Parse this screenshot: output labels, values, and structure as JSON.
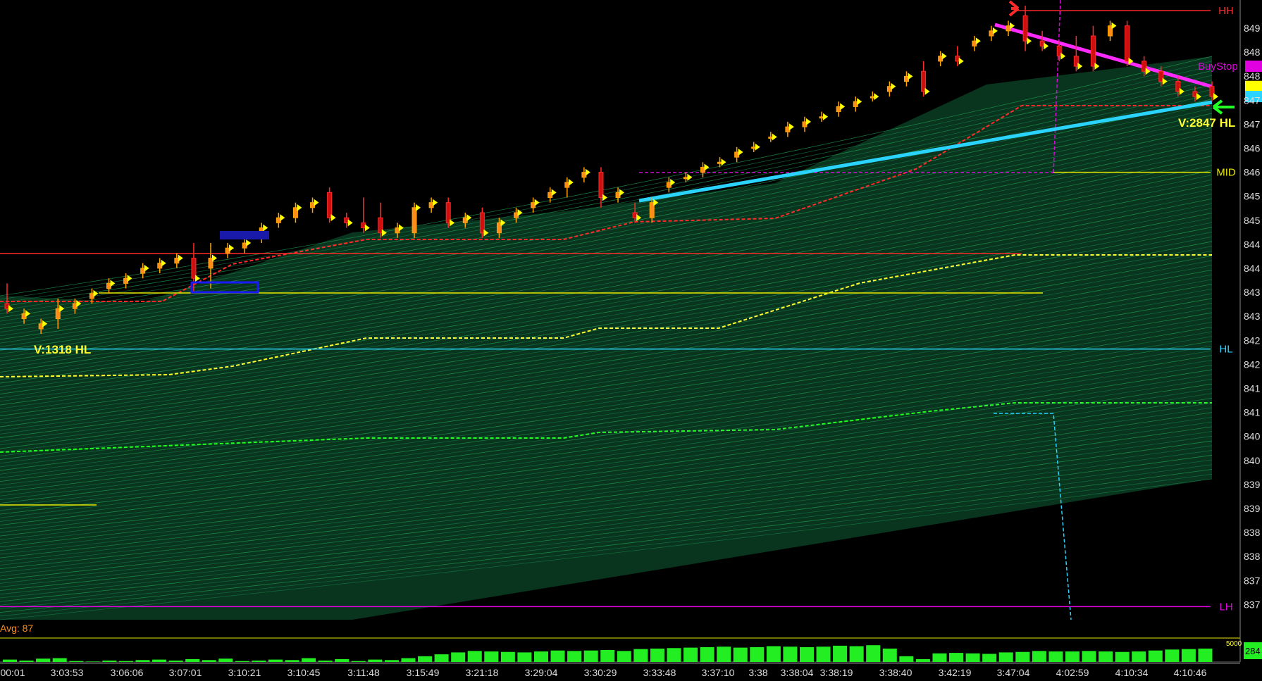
{
  "chart_data": {
    "type": "candlestick",
    "x_tick_labels": [
      "00:01",
      "3:03:53",
      "3:06:06",
      "3:07:01",
      "3:10:21",
      "3:10:45",
      "3:11:48",
      "3:15:49",
      "3:21:18",
      "3:29:04",
      "3:30:29",
      "3:33:48",
      "3:37:10",
      "3:38",
      "3:38:04",
      "3:38:19",
      "3:38:40",
      "3:42:19",
      "3:47:04",
      "4:02:59",
      "4:10:34",
      "4:10:46"
    ],
    "y_tick_labels": [
      "849",
      "848",
      "848",
      "847",
      "847",
      "846",
      "846",
      "845",
      "845",
      "844",
      "844",
      "843",
      "843",
      "842",
      "842",
      "841",
      "841",
      "840",
      "840",
      "839",
      "839",
      "838",
      "838",
      "837",
      "837"
    ],
    "ylim": [
      8370,
      8493
    ],
    "candles": [
      {
        "o": 8434,
        "h": 8438,
        "l": 8432,
        "c": 8433
      },
      {
        "o": 8431,
        "h": 8433,
        "l": 8430,
        "c": 8432
      },
      {
        "o": 8429,
        "h": 8431,
        "l": 8428,
        "c": 8430
      },
      {
        "o": 8431,
        "h": 8435,
        "l": 8429,
        "c": 8433
      },
      {
        "o": 8433,
        "h": 8435,
        "l": 8432,
        "c": 8434
      },
      {
        "o": 8435,
        "h": 8437,
        "l": 8434,
        "c": 8436
      },
      {
        "o": 8437,
        "h": 8439,
        "l": 8436,
        "c": 8438
      },
      {
        "o": 8438,
        "h": 8440,
        "l": 8437,
        "c": 8439
      },
      {
        "o": 8440,
        "h": 8442,
        "l": 8439,
        "c": 8441
      },
      {
        "o": 8441,
        "h": 8443,
        "l": 8440,
        "c": 8442
      },
      {
        "o": 8442,
        "h": 8444,
        "l": 8441,
        "c": 8443
      },
      {
        "o": 8443,
        "h": 8446,
        "l": 8436,
        "c": 8439
      },
      {
        "o": 8441,
        "h": 8446,
        "l": 8437,
        "c": 8443
      },
      {
        "o": 8444,
        "h": 8446,
        "l": 8443,
        "c": 8445
      },
      {
        "o": 8445,
        "h": 8447,
        "l": 8444,
        "c": 8446
      },
      {
        "o": 8447,
        "h": 8450,
        "l": 8446,
        "c": 8449
      },
      {
        "o": 8450,
        "h": 8452,
        "l": 8449,
        "c": 8451
      },
      {
        "o": 8451,
        "h": 8454,
        "l": 8450,
        "c": 8453
      },
      {
        "o": 8453,
        "h": 8455,
        "l": 8452,
        "c": 8454
      },
      {
        "o": 8456,
        "h": 8457,
        "l": 8450,
        "c": 8451
      },
      {
        "o": 8451,
        "h": 8452,
        "l": 8449,
        "c": 8450
      },
      {
        "o": 8450,
        "h": 8455,
        "l": 8448,
        "c": 8449
      },
      {
        "o": 8451,
        "h": 8454,
        "l": 8447,
        "c": 8448
      },
      {
        "o": 8448,
        "h": 8450,
        "l": 8447,
        "c": 8449
      },
      {
        "o": 8448,
        "h": 8454,
        "l": 8447,
        "c": 8453
      },
      {
        "o": 8453,
        "h": 8455,
        "l": 8452,
        "c": 8454
      },
      {
        "o": 8454,
        "h": 8455,
        "l": 8449,
        "c": 8450
      },
      {
        "o": 8450,
        "h": 8452,
        "l": 8449,
        "c": 8451
      },
      {
        "o": 8452,
        "h": 8453,
        "l": 8447,
        "c": 8448
      },
      {
        "o": 8448,
        "h": 8451,
        "l": 8447,
        "c": 8450
      },
      {
        "o": 8451,
        "h": 8453,
        "l": 8450,
        "c": 8452
      },
      {
        "o": 8453,
        "h": 8455,
        "l": 8452,
        "c": 8454
      },
      {
        "o": 8455,
        "h": 8457,
        "l": 8454,
        "c": 8456
      },
      {
        "o": 8457,
        "h": 8459,
        "l": 8455,
        "c": 8458
      },
      {
        "o": 8459,
        "h": 8461,
        "l": 8458,
        "c": 8460
      },
      {
        "o": 8460,
        "h": 8461,
        "l": 8453,
        "c": 8455
      },
      {
        "o": 8455,
        "h": 8457,
        "l": 8454,
        "c": 8456
      },
      {
        "o": 8452,
        "h": 8454,
        "l": 8450,
        "c": 8451
      },
      {
        "o": 8451,
        "h": 8455,
        "l": 8450,
        "c": 8454
      },
      {
        "o": 8457,
        "h": 8459,
        "l": 8456,
        "c": 8458
      },
      {
        "o": 8459,
        "h": 8460,
        "l": 8458,
        "c": 8459
      },
      {
        "o": 8460,
        "h": 8462,
        "l": 8459,
        "c": 8461
      },
      {
        "o": 8462,
        "h": 8463,
        "l": 8461,
        "c": 8462
      },
      {
        "o": 8463,
        "h": 8465,
        "l": 8462,
        "c": 8464
      },
      {
        "o": 8465,
        "h": 8466,
        "l": 8464,
        "c": 8465
      },
      {
        "o": 8467,
        "h": 8468,
        "l": 8466,
        "c": 8467
      },
      {
        "o": 8468,
        "h": 8470,
        "l": 8467,
        "c": 8469
      },
      {
        "o": 8469,
        "h": 8471,
        "l": 8468,
        "c": 8470
      },
      {
        "o": 8471,
        "h": 8472,
        "l": 8470,
        "c": 8471
      },
      {
        "o": 8472,
        "h": 8474,
        "l": 8471,
        "c": 8473
      },
      {
        "o": 8473,
        "h": 8475,
        "l": 8472,
        "c": 8474
      },
      {
        "o": 8475,
        "h": 8476,
        "l": 8474,
        "c": 8475
      },
      {
        "o": 8476,
        "h": 8478,
        "l": 8475,
        "c": 8477
      },
      {
        "o": 8478,
        "h": 8480,
        "l": 8477,
        "c": 8479
      },
      {
        "o": 8480,
        "h": 8482,
        "l": 8475,
        "c": 8476
      },
      {
        "o": 8482,
        "h": 8484,
        "l": 8481,
        "c": 8483
      },
      {
        "o": 8483,
        "h": 8485,
        "l": 8481,
        "c": 8482
      },
      {
        "o": 8485,
        "h": 8487,
        "l": 8484,
        "c": 8486
      },
      {
        "o": 8487,
        "h": 8489,
        "l": 8486,
        "c": 8488
      },
      {
        "o": 8488,
        "h": 8490,
        "l": 8487,
        "c": 8489
      },
      {
        "o": 8491,
        "h": 8493,
        "l": 8484,
        "c": 8486
      },
      {
        "o": 8486,
        "h": 8488,
        "l": 8484,
        "c": 8485
      },
      {
        "o": 8485,
        "h": 8486,
        "l": 8482,
        "c": 8483
      },
      {
        "o": 8483,
        "h": 8487,
        "l": 8480,
        "c": 8481
      },
      {
        "o": 8487,
        "h": 8489,
        "l": 8480,
        "c": 8481
      },
      {
        "o": 8487,
        "h": 8490,
        "l": 8486,
        "c": 8489
      },
      {
        "o": 8489,
        "h": 8490,
        "l": 8481,
        "c": 8482
      },
      {
        "o": 8482,
        "h": 8483,
        "l": 8479,
        "c": 8480
      },
      {
        "o": 8480,
        "h": 8481,
        "l": 8477,
        "c": 8478
      },
      {
        "o": 8478,
        "h": 8479,
        "l": 8475,
        "c": 8476
      },
      {
        "o": 8476,
        "h": 8477,
        "l": 8474,
        "c": 8475
      },
      {
        "o": 8477,
        "h": 8478,
        "l": 8474,
        "c": 8475
      }
    ],
    "levels": [
      {
        "label": "HH",
        "value": 8492,
        "color": "#ff2a2a"
      },
      {
        "label": "MID",
        "value": 8460,
        "color": "#e8e800"
      },
      {
        "label": "HL",
        "value": 8425,
        "color": "#2ad4ff"
      },
      {
        "label": "LH",
        "value": 8374,
        "color": "#e000e0"
      }
    ],
    "price_tags": [
      {
        "label": "BuyStop",
        "value": 8481,
        "color": "#e000e0"
      },
      {
        "value": 8477,
        "color": "#ffff00"
      },
      {
        "value": 8475,
        "color": "#2ad4ff"
      }
    ],
    "annotations": [
      "V:1318 HL",
      "V:2847 HL",
      "Avg: 87"
    ],
    "volume_axis_label": "5000",
    "volume_readout": "284",
    "volume": [
      500,
      300,
      700,
      800,
      200,
      100,
      300,
      200,
      400,
      500,
      300,
      600,
      400,
      700,
      200,
      300,
      500,
      400,
      800,
      300,
      600,
      200,
      500,
      400,
      800,
      1200,
      1600,
      2000,
      2300,
      2200,
      2100,
      2000,
      2200,
      2400,
      2300,
      2400,
      2500,
      2300,
      2700,
      2800,
      2900,
      3000,
      3100,
      3200,
      3000,
      3100,
      3300,
      3200,
      3100,
      3200,
      3400,
      3300,
      3500,
      2800,
      1200,
      600,
      1800,
      1900,
      1800,
      1700,
      2000,
      2100,
      2300,
      2200,
      2200,
      2300,
      2200,
      2100,
      2200,
      2400,
      2600,
      2700,
      2800
    ],
    "grid": false
  }
}
